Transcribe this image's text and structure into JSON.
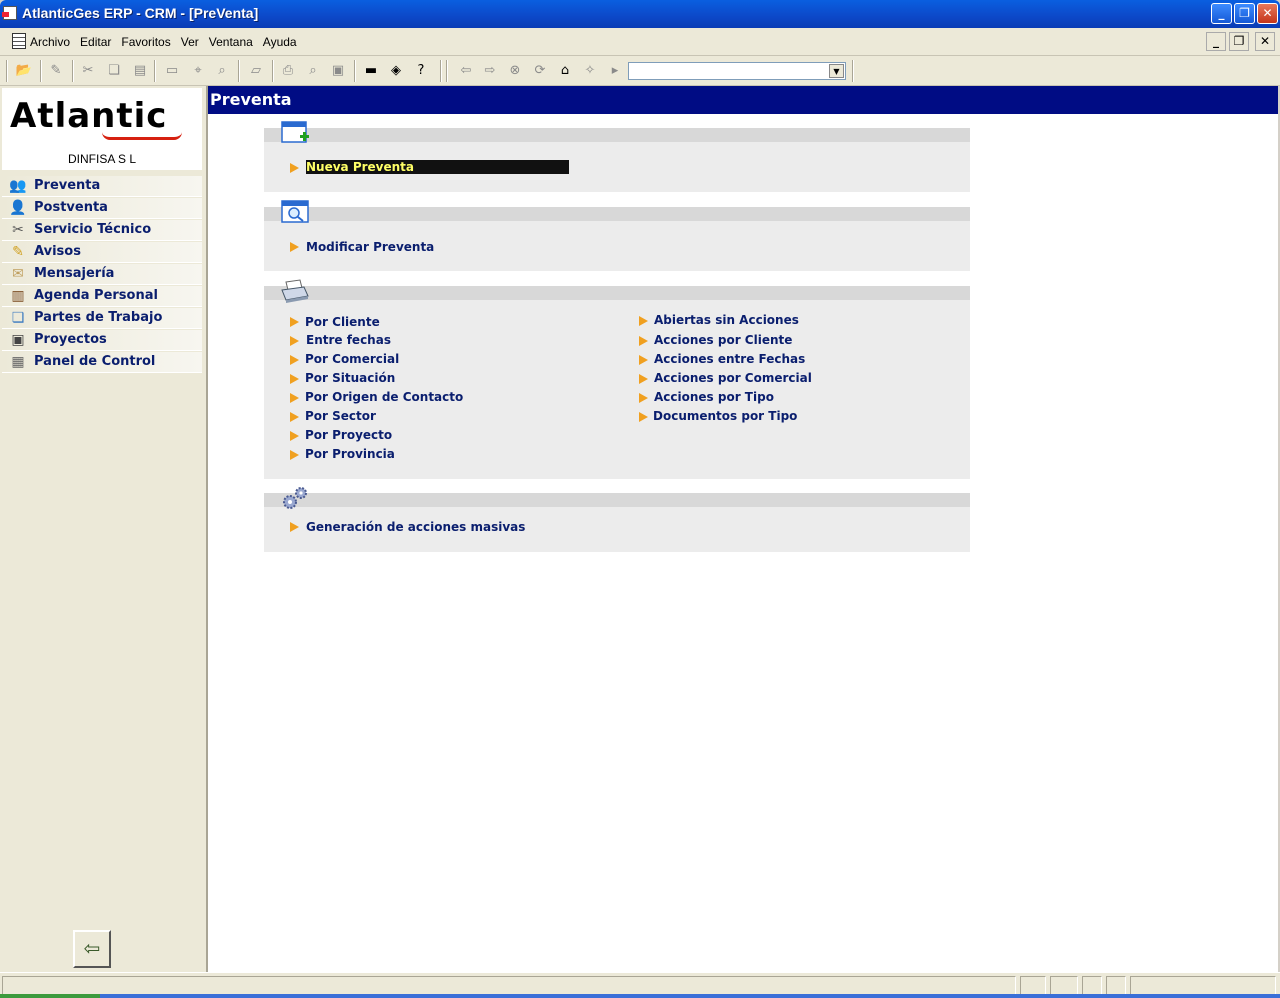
{
  "window": {
    "title": "AtlanticGes ERP - CRM - [PreVenta]"
  },
  "menu": [
    {
      "label": "Archivo"
    },
    {
      "label": "Editar"
    },
    {
      "label": "Favoritos"
    },
    {
      "label": "Ver"
    },
    {
      "label": "Ventana"
    },
    {
      "label": "Ayuda"
    }
  ],
  "sidebar": {
    "logo_text": "Atlantic",
    "company": "DINFISA  S L",
    "items": [
      {
        "label": "Preventa",
        "icon": "people-icon"
      },
      {
        "label": "Postventa",
        "icon": "person-icon"
      },
      {
        "label": "Servicio Técnico",
        "icon": "tools-icon"
      },
      {
        "label": "Avisos",
        "icon": "pencil-icon"
      },
      {
        "label": "Mensajería",
        "icon": "envelope-icon"
      },
      {
        "label": "Agenda Personal",
        "icon": "book-icon"
      },
      {
        "label": "Partes de Trabajo",
        "icon": "paper-icon"
      },
      {
        "label": "Proyectos",
        "icon": "monitor-icon"
      },
      {
        "label": "Panel de Control",
        "icon": "calendar-icon"
      }
    ]
  },
  "main": {
    "header": "Preventa",
    "sections": {
      "new": {
        "icon": "window-add-icon",
        "links": [
          "Nueva Preventa"
        ]
      },
      "modify": {
        "icon": "window-search-icon",
        "links": [
          "Modificar Preventa"
        ]
      },
      "reports": {
        "icon": "printer-icon",
        "left": [
          "Por Cliente",
          "Entre fechas",
          "Por Comercial",
          "Por Situación",
          "Por Origen de Contacto",
          "Por Sector",
          "Por Proyecto",
          "Por Provincia"
        ],
        "right": [
          "Abiertas sin Acciones",
          "Acciones por Cliente",
          "Acciones entre Fechas",
          "Acciones por Comercial",
          "Acciones por Tipo",
          "Documentos por Tipo"
        ]
      },
      "mass": {
        "icon": "gears-icon",
        "links": [
          "Generación de acciones masivas"
        ]
      }
    }
  },
  "colors": {
    "header_bg": "#000c84",
    "link": "#0a1e6e",
    "bullet": "#f0a020",
    "selected_bg": "#111111",
    "selected_text": "#ffff66"
  }
}
